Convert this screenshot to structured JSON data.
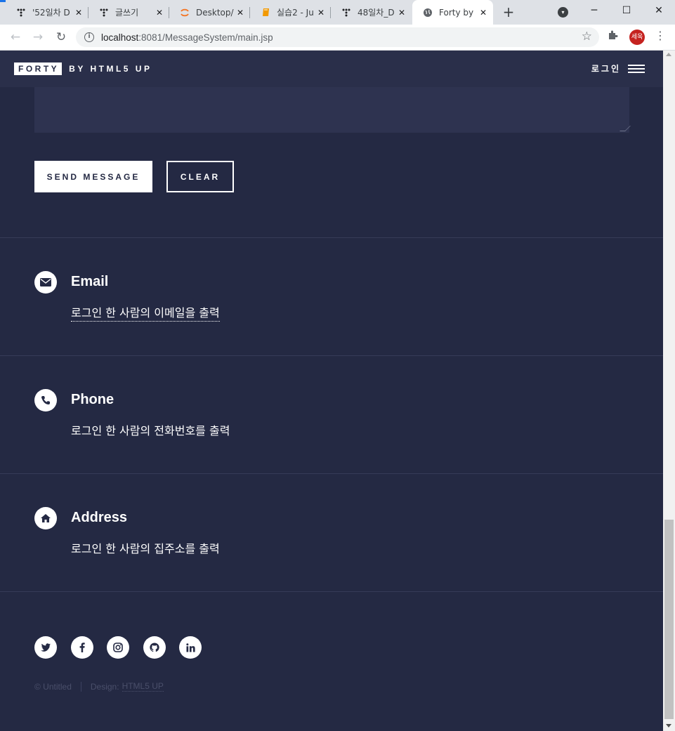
{
  "browser": {
    "tabs": [
      {
        "title": "'52일차 D",
        "icon": "tistory-icon",
        "active": false
      },
      {
        "title": "글쓰기",
        "icon": "tistory-icon",
        "active": false
      },
      {
        "title": "Desktop/",
        "icon": "jupyter-icon",
        "active": false
      },
      {
        "title": "실습2 - Ju",
        "icon": "notebook-icon",
        "active": false
      },
      {
        "title": "48일차_D",
        "icon": "tistory-icon",
        "active": false
      },
      {
        "title": "Forty by",
        "icon": "globe-icon",
        "active": true
      }
    ],
    "new_tab_symbol": "+",
    "url_host": "localhost",
    "url_rest": ":8081/MessageSystem/main.jsp",
    "profile_initials": "세욱"
  },
  "header": {
    "logo_primary": "FORTY",
    "logo_secondary": "BY HTML5 UP",
    "menu_label": "로그인"
  },
  "form": {
    "send_label": "SEND MESSAGE",
    "clear_label": "CLEAR"
  },
  "contacts": [
    {
      "icon": "envelope-icon",
      "title": "Email",
      "value": "로그인 한 사람의 이메일을 출력"
    },
    {
      "icon": "phone-icon",
      "title": "Phone",
      "value": "로그인 한 사람의 전화번호를 출력"
    },
    {
      "icon": "home-icon",
      "title": "Address",
      "value": "로그인 한 사람의 집주소를 출력"
    }
  ],
  "social": [
    "twitter-icon",
    "facebook-icon",
    "instagram-icon",
    "github-icon",
    "linkedin-icon"
  ],
  "footer": {
    "copyright": "© Untitled",
    "design_label": "Design:",
    "design_link": "HTML5 UP"
  },
  "colors": {
    "page_bg": "#242943",
    "header_bg": "#2a2f4a",
    "accent": "#ffffff"
  }
}
